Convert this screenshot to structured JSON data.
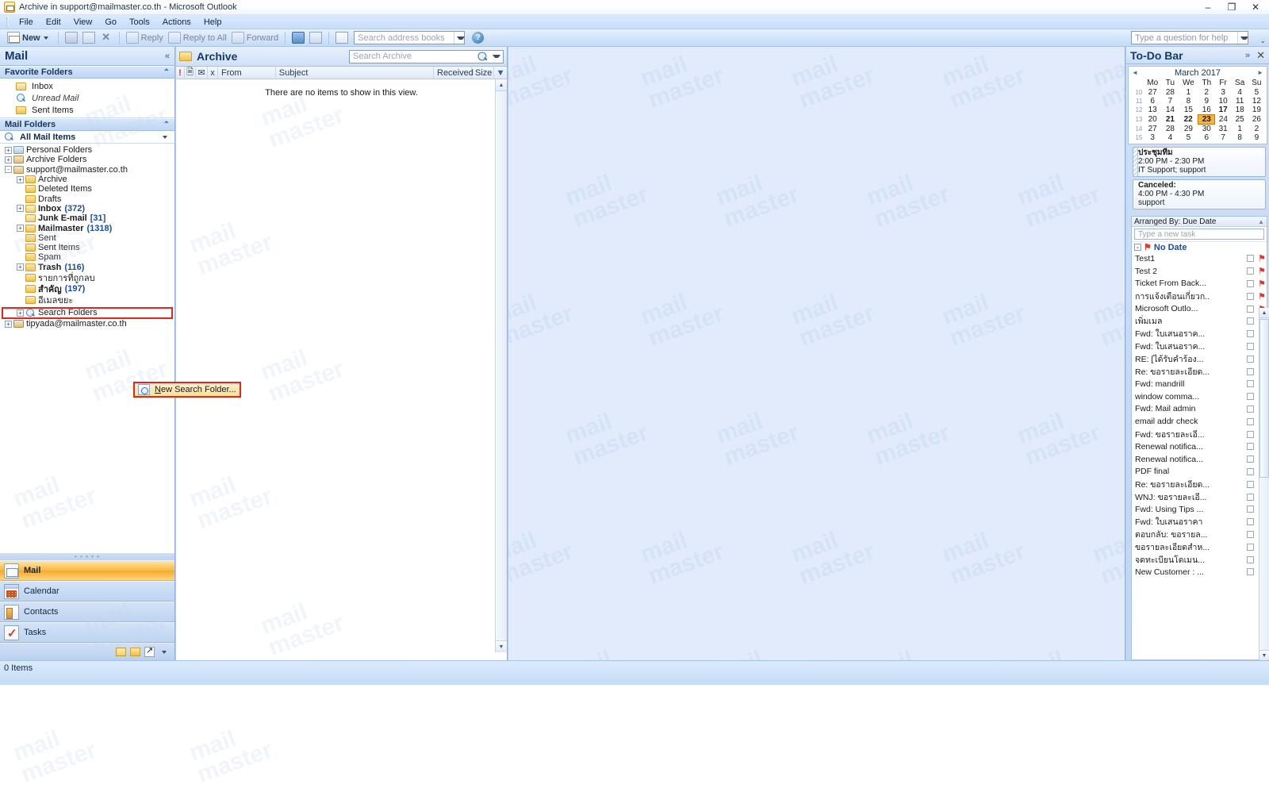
{
  "window": {
    "title": "Archive in support@mailmaster.co.th - Microsoft Outlook",
    "icon": "outlook-icon",
    "minimize": "–",
    "restore": "❐",
    "close": "✕"
  },
  "menubar": {
    "items": [
      "File",
      "Edit",
      "View",
      "Go",
      "Tools",
      "Actions",
      "Help"
    ]
  },
  "toolbar": {
    "new_label": "New",
    "reply_label": "Reply",
    "reply_all_label": "Reply to All",
    "forward_label": "Forward",
    "address_search_placeholder": "Search address books",
    "help_placeholder": "Type a question for help",
    "overflow": "⌄"
  },
  "navpane": {
    "title": "Mail",
    "collapse_icon": "«",
    "favorite_folders": {
      "header": "Favorite Folders",
      "collapse_icon": "⌃",
      "items": [
        {
          "label": "Inbox",
          "italic": false
        },
        {
          "label": "Unread Mail",
          "italic": true
        },
        {
          "label": "Sent Items",
          "italic": false
        }
      ]
    },
    "mail_folders": {
      "header": "Mail Folders",
      "collapse_icon": "⌃",
      "scope_selector": "All Mail Items",
      "tree": [
        {
          "label": "Personal Folders",
          "indent": 0,
          "expander": "+",
          "icon": "personal-folders-icon",
          "bold": false,
          "count": ""
        },
        {
          "label": "Archive Folders",
          "indent": 0,
          "expander": "+",
          "icon": "archive-folders-icon",
          "bold": false,
          "count": ""
        },
        {
          "label": "support@mailmaster.co.th",
          "indent": 0,
          "expander": "-",
          "icon": "mailbox-icon",
          "bold": false,
          "count": ""
        },
        {
          "label": "Archive",
          "indent": 1,
          "expander": "+",
          "icon": "folder-icon",
          "bold": false,
          "count": ""
        },
        {
          "label": "Deleted Items",
          "indent": 1,
          "expander": "",
          "icon": "folder-icon",
          "bold": false,
          "count": ""
        },
        {
          "label": "Drafts",
          "indent": 1,
          "expander": "",
          "icon": "folder-icon",
          "bold": false,
          "count": ""
        },
        {
          "label": "Inbox",
          "indent": 1,
          "expander": "+",
          "icon": "inbox-icon",
          "bold": true,
          "count": "(372)"
        },
        {
          "label": "Junk E-mail",
          "indent": 1,
          "expander": "",
          "icon": "junk-icon",
          "bold": true,
          "count": "[31]"
        },
        {
          "label": "Mailmaster",
          "indent": 1,
          "expander": "+",
          "icon": "folder-icon",
          "bold": true,
          "count": "(1318)"
        },
        {
          "label": "Sent",
          "indent": 1,
          "expander": "",
          "icon": "folder-icon",
          "bold": false,
          "count": ""
        },
        {
          "label": "Sent Items",
          "indent": 1,
          "expander": "",
          "icon": "folder-icon",
          "bold": false,
          "count": ""
        },
        {
          "label": "Spam",
          "indent": 1,
          "expander": "",
          "icon": "folder-icon",
          "bold": false,
          "count": ""
        },
        {
          "label": "Trash",
          "indent": 1,
          "expander": "+",
          "icon": "folder-icon",
          "bold": true,
          "count": "(116)"
        },
        {
          "label": "รายการที่ถูกลบ",
          "indent": 1,
          "expander": "",
          "icon": "folder-icon",
          "bold": false,
          "count": ""
        },
        {
          "label": "สำคัญ",
          "indent": 1,
          "expander": "",
          "icon": "folder-icon",
          "bold": true,
          "count": "(197)"
        },
        {
          "label": "อีเมลขยะ",
          "indent": 1,
          "expander": "",
          "icon": "folder-icon",
          "bold": false,
          "count": ""
        }
      ],
      "search_folders": {
        "label": "Search Folders",
        "expander": "+",
        "icon": "search-folder-icon",
        "highlighted": true
      },
      "other_mailbox": {
        "label": "tipyada@mailmaster.co.th",
        "expander": "+",
        "icon": "mailbox-icon"
      }
    },
    "context_menu": {
      "items": [
        {
          "label": "New Search Folder...",
          "underline_index": 0,
          "icon": "new-search-folder-icon"
        }
      ]
    },
    "modules": [
      {
        "label": "Mail",
        "icon": "mail-icon",
        "active": true
      },
      {
        "label": "Calendar",
        "icon": "calendar-icon",
        "active": false
      },
      {
        "label": "Contacts",
        "icon": "contacts-icon",
        "active": false
      },
      {
        "label": "Tasks",
        "icon": "tasks-icon",
        "active": false
      }
    ]
  },
  "messagelist": {
    "folder_title": "Archive",
    "folder_icon": "folder-icon",
    "search_placeholder": "Search Archive",
    "columns": [
      {
        "label": "!",
        "name": "importance"
      },
      {
        "label": "὜b",
        "name": "icon"
      },
      {
        "label": "✉",
        "name": "flag"
      },
      {
        "label": "̄",
        "name": "attachment"
      },
      {
        "label": "From",
        "name": "from"
      },
      {
        "label": "Subject",
        "name": "subject"
      },
      {
        "label": "Received",
        "name": "received"
      },
      {
        "label": "Size",
        "name": "size"
      }
    ],
    "empty_text": "There are no items to show in this view.",
    "rows": []
  },
  "readingpane": {
    "watermark_text": "mail\nmaster",
    "background_color": "#e1ebfb"
  },
  "todobar": {
    "title": "To-Do Bar",
    "expand_icon": "»",
    "close_icon": "✕",
    "datepicker": {
      "month_label": "March 2017",
      "prev": "◄",
      "next": "►",
      "day_headers": [
        "Mo",
        "Tu",
        "We",
        "Th",
        "Fr",
        "Sa",
        "Su"
      ],
      "weeks": [
        {
          "wk": "10",
          "days": [
            {
              "d": "27",
              "out": true
            },
            {
              "d": "28",
              "out": true
            },
            {
              "d": "1"
            },
            {
              "d": "2"
            },
            {
              "d": "3"
            },
            {
              "d": "4"
            },
            {
              "d": "5"
            }
          ]
        },
        {
          "wk": "11",
          "days": [
            {
              "d": "6"
            },
            {
              "d": "7"
            },
            {
              "d": "8"
            },
            {
              "d": "9"
            },
            {
              "d": "10"
            },
            {
              "d": "11"
            },
            {
              "d": "12"
            }
          ]
        },
        {
          "wk": "12",
          "days": [
            {
              "d": "13"
            },
            {
              "d": "14"
            },
            {
              "d": "15"
            },
            {
              "d": "16"
            },
            {
              "d": "17",
              "bold": true
            },
            {
              "d": "18"
            },
            {
              "d": "19"
            }
          ]
        },
        {
          "wk": "13",
          "days": [
            {
              "d": "20"
            },
            {
              "d": "21",
              "bold": true
            },
            {
              "d": "22",
              "bold": true
            },
            {
              "d": "23",
              "today": true
            },
            {
              "d": "24"
            },
            {
              "d": "25"
            },
            {
              "d": "26"
            }
          ]
        },
        {
          "wk": "14",
          "days": [
            {
              "d": "27"
            },
            {
              "d": "28"
            },
            {
              "d": "29"
            },
            {
              "d": "30"
            },
            {
              "d": "31"
            },
            {
              "d": "1",
              "out": true
            },
            {
              "d": "2",
              "out": true
            }
          ]
        },
        {
          "wk": "15",
          "days": [
            {
              "d": "3",
              "out": true
            },
            {
              "d": "4",
              "out": true
            },
            {
              "d": "5",
              "out": true
            },
            {
              "d": "6",
              "out": true
            },
            {
              "d": "7",
              "out": true
            },
            {
              "d": "8",
              "out": true
            },
            {
              "d": "9",
              "out": true
            }
          ]
        }
      ]
    },
    "appointments": [
      {
        "subject": "ประชุมทีม",
        "time": "2:00 PM - 2:30 PM",
        "location": "IT Support; support",
        "striped": true
      },
      {
        "subject": "Canceled:",
        "time": "4:00 PM - 4:30 PM",
        "location": "support",
        "striped": false
      }
    ],
    "tasks": {
      "arranged_by": "Arranged By: Due Date",
      "sort_icon": "▲",
      "new_task_placeholder": "Type a new task",
      "group_label": "No Date",
      "group_expander": "-",
      "items": [
        "Test1",
        "Test 2",
        "Ticket From Back...",
        "การแจ้งเตือนเกี่ยวก..",
        "Microsoft Outlo...",
        "เพิ่มเมล",
        "Fwd: ใบเสนอราค...",
        "Fwd: ใบเสนอราค...",
        "RE: [ได้รับคำร้อง...",
        "Re: ขอรายละเอียด...",
        "Fwd: mandrill",
        "window comma...",
        "Fwd: Mail admin",
        "email addr check",
        "Fwd: ขอรายละเอี...",
        "Renewal notifica...",
        "Renewal notifica...",
        "PDF final",
        "Re: ขอรายละเอียด...",
        "WNJ: ขอรายละเอี...",
        "Fwd: Using Tips ...",
        "Fwd: ใบเสนอราคา",
        "ตอบกลับ: ขอรายล...",
        "ขอรายละเอียดสำห...",
        "จดทะเบียนโดเมน...",
        "New Customer : ..."
      ]
    }
  },
  "statusbar": {
    "text": "0 Items"
  },
  "colors": {
    "accent": "#f7a92a",
    "highlight_red": "#e8241b",
    "link_blue": "#1b4d9b",
    "pane_blue": "#e1ebfb"
  }
}
